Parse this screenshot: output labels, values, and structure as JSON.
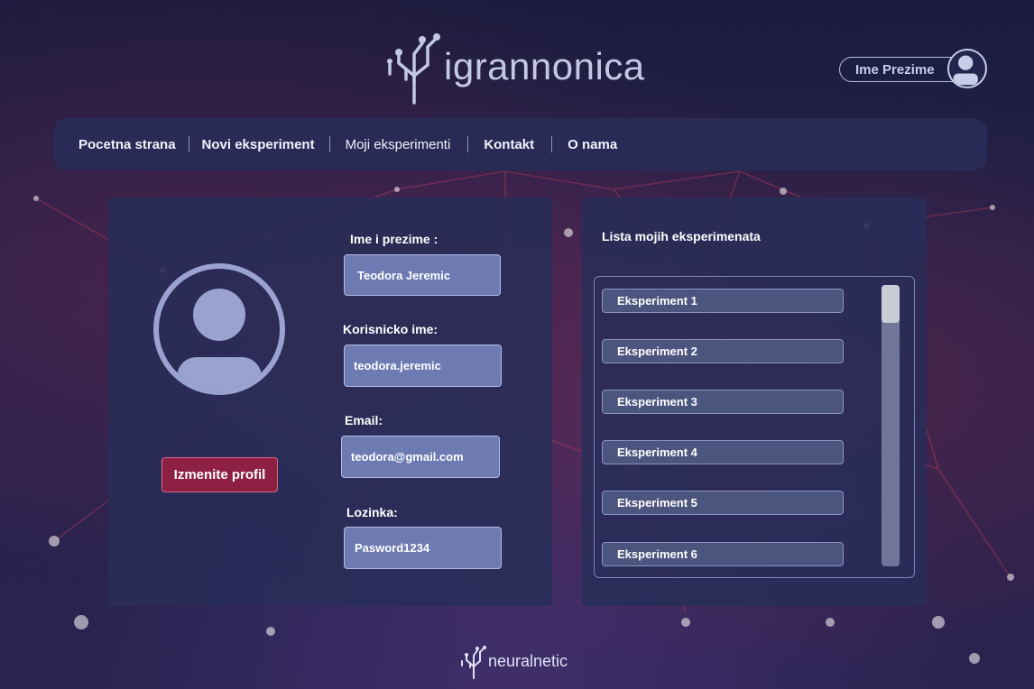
{
  "brand": {
    "logo_text": "igrannonica",
    "footer_text": "neuralnetic"
  },
  "user": {
    "name": "Ime Prezime"
  },
  "nav": {
    "items": [
      {
        "label": "Pocetna strana"
      },
      {
        "label": "Novi eksperiment"
      },
      {
        "label": "Moji eksperimenti"
      },
      {
        "label": "Kontakt"
      },
      {
        "label": "O nama"
      }
    ]
  },
  "profile": {
    "edit_button": "Izmenite profil",
    "fields": [
      {
        "label": "Ime i prezime :",
        "value": "Teodora Jeremic"
      },
      {
        "label": "Korisnicko ime:",
        "value": "teodora.jeremic"
      },
      {
        "label": "Email:",
        "value": "teodora@gmail.com"
      },
      {
        "label": "Lozinka:",
        "value": "Pasword1234"
      }
    ]
  },
  "experiments": {
    "title": "Lista mojih eksperimenata",
    "items": [
      {
        "label": "Eksperiment 1"
      },
      {
        "label": "Eksperiment 2"
      },
      {
        "label": "Eksperiment 3"
      },
      {
        "label": "Eksperiment 4"
      },
      {
        "label": "Eksperiment 5"
      },
      {
        "label": "Eksperiment 6"
      }
    ]
  },
  "colors": {
    "accent_button": "#8e2044",
    "field_fill": "#6e7bb2",
    "nav_bg": "#282c58"
  }
}
